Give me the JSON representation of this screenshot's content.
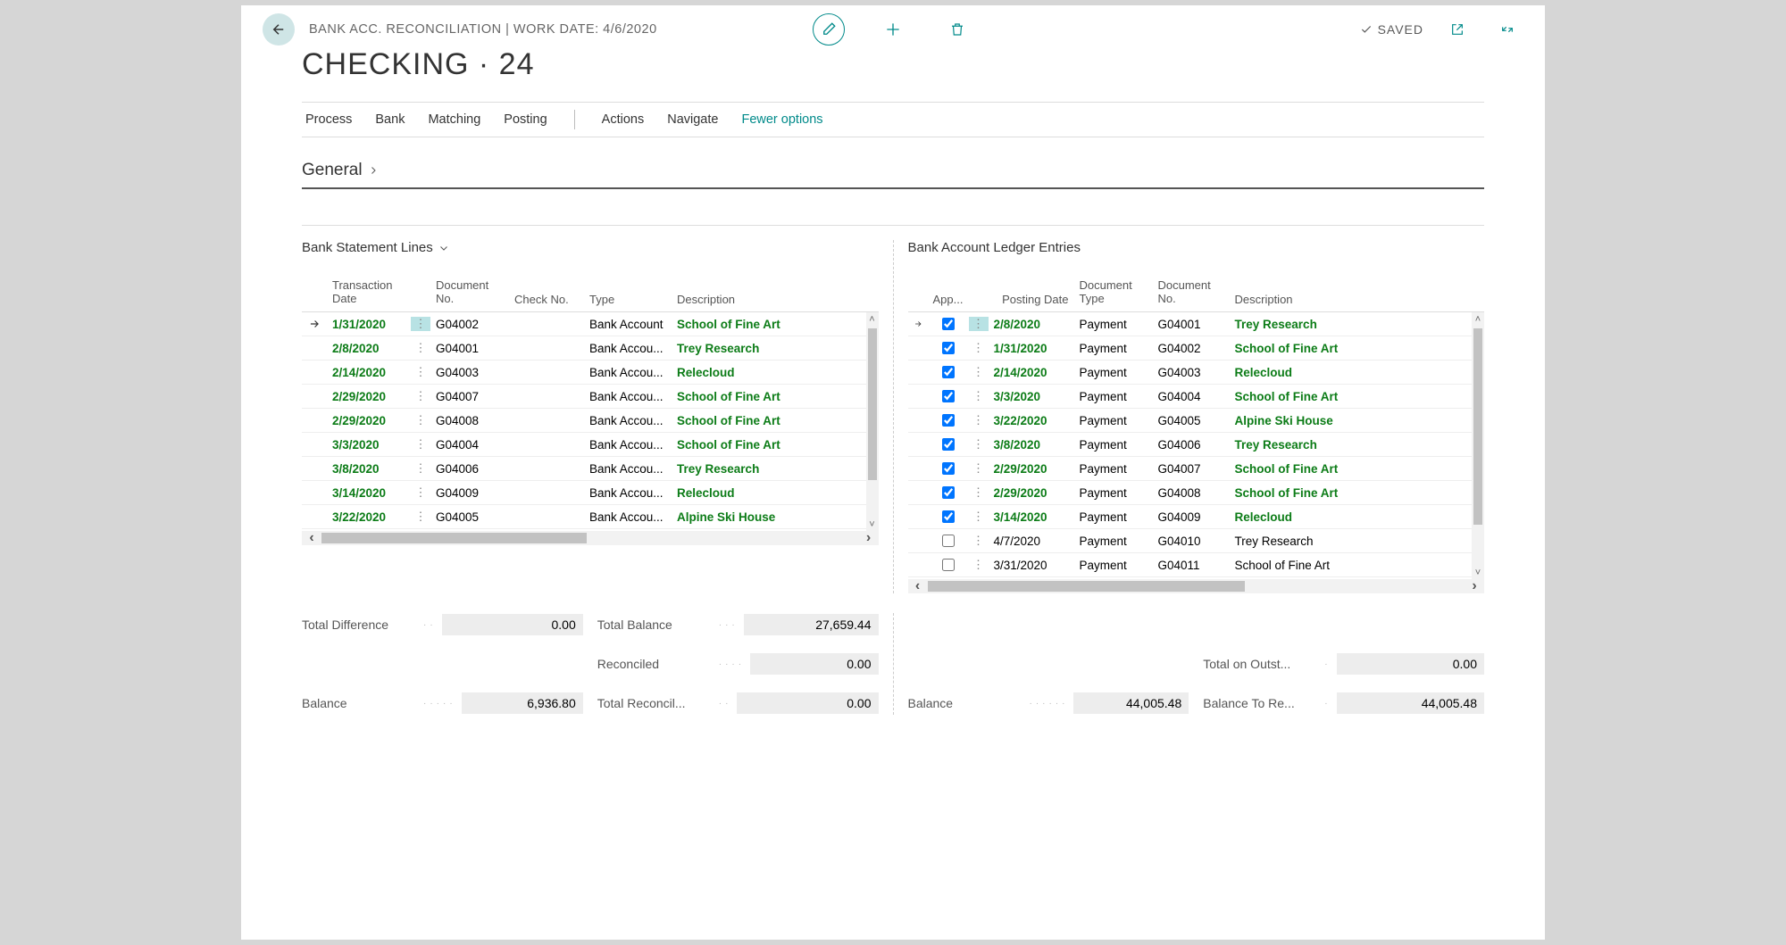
{
  "header": {
    "breadcrumb": "BANK ACC. RECONCILIATION | WORK DATE: 4/6/2020",
    "title": "CHECKING · 24",
    "saved_label": "SAVED"
  },
  "menu": {
    "process": "Process",
    "bank": "Bank",
    "matching": "Matching",
    "posting": "Posting",
    "actions": "Actions",
    "navigate": "Navigate",
    "fewer": "Fewer options"
  },
  "general": {
    "label": "General"
  },
  "leftPane": {
    "title": "Bank Statement Lines",
    "cols": {
      "txndate": "Transaction Date",
      "docno": "Document No.",
      "checkno": "Check No.",
      "type": "Type",
      "desc": "Description"
    },
    "rows": [
      {
        "date": "1/31/2020",
        "doc": "G04002",
        "type": "Bank Account",
        "desc": "School of Fine Art",
        "selected": true
      },
      {
        "date": "2/8/2020",
        "doc": "G04001",
        "type": "Bank Accou...",
        "desc": "Trey Research"
      },
      {
        "date": "2/14/2020",
        "doc": "G04003",
        "type": "Bank Accou...",
        "desc": "Relecloud"
      },
      {
        "date": "2/29/2020",
        "doc": "G04007",
        "type": "Bank Accou...",
        "desc": "School of Fine Art"
      },
      {
        "date": "2/29/2020",
        "doc": "G04008",
        "type": "Bank Accou...",
        "desc": "School of Fine Art"
      },
      {
        "date": "3/3/2020",
        "doc": "G04004",
        "type": "Bank Accou...",
        "desc": "School of Fine Art"
      },
      {
        "date": "3/8/2020",
        "doc": "G04006",
        "type": "Bank Accou...",
        "desc": "Trey Research"
      },
      {
        "date": "3/14/2020",
        "doc": "G04009",
        "type": "Bank Accou...",
        "desc": "Relecloud"
      },
      {
        "date": "3/22/2020",
        "doc": "G04005",
        "type": "Bank Accou...",
        "desc": "Alpine Ski House"
      }
    ]
  },
  "rightPane": {
    "title": "Bank Account Ledger Entries",
    "cols": {
      "app": "App...",
      "posting": "Posting Date",
      "doctype": "Document Type",
      "docno": "Document No.",
      "desc": "Description"
    },
    "rows": [
      {
        "checked": true,
        "date": "2/8/2020",
        "type": "Payment",
        "doc": "G04001",
        "desc": "Trey Research",
        "matched": true,
        "selected": true
      },
      {
        "checked": true,
        "date": "1/31/2020",
        "type": "Payment",
        "doc": "G04002",
        "desc": "School of Fine Art",
        "matched": true
      },
      {
        "checked": true,
        "date": "2/14/2020",
        "type": "Payment",
        "doc": "G04003",
        "desc": "Relecloud",
        "matched": true
      },
      {
        "checked": true,
        "date": "3/3/2020",
        "type": "Payment",
        "doc": "G04004",
        "desc": "School of Fine Art",
        "matched": true
      },
      {
        "checked": true,
        "date": "3/22/2020",
        "type": "Payment",
        "doc": "G04005",
        "desc": "Alpine Ski House",
        "matched": true
      },
      {
        "checked": true,
        "date": "3/8/2020",
        "type": "Payment",
        "doc": "G04006",
        "desc": "Trey Research",
        "matched": true
      },
      {
        "checked": true,
        "date": "2/29/2020",
        "type": "Payment",
        "doc": "G04007",
        "desc": "School of Fine Art",
        "matched": true
      },
      {
        "checked": true,
        "date": "2/29/2020",
        "type": "Payment",
        "doc": "G04008",
        "desc": "School of Fine Art",
        "matched": true
      },
      {
        "checked": true,
        "date": "3/14/2020",
        "type": "Payment",
        "doc": "G04009",
        "desc": "Relecloud",
        "matched": true
      },
      {
        "checked": false,
        "date": "4/7/2020",
        "type": "Payment",
        "doc": "G04010",
        "desc": "Trey Research",
        "matched": false
      },
      {
        "checked": false,
        "date": "3/31/2020",
        "type": "Payment",
        "doc": "G04011",
        "desc": "School of Fine Art",
        "matched": false
      }
    ]
  },
  "totals": {
    "total_difference_label": "Total Difference",
    "total_difference": "0.00",
    "balance_left_label": "Balance",
    "balance_left": "6,936.80",
    "total_balance_label": "Total Balance",
    "total_balance": "27,659.44",
    "reconciled_label": "Reconciled",
    "reconciled": "0.00",
    "total_reconcil_label": "Total Reconcil...",
    "total_reconcil": "0.00",
    "balance_right_label": "Balance",
    "balance_right": "44,005.48",
    "total_outst_label": "Total on Outst...",
    "total_outst": "0.00",
    "balance_to_re_label": "Balance To Re...",
    "balance_to_re": "44,005.48"
  }
}
